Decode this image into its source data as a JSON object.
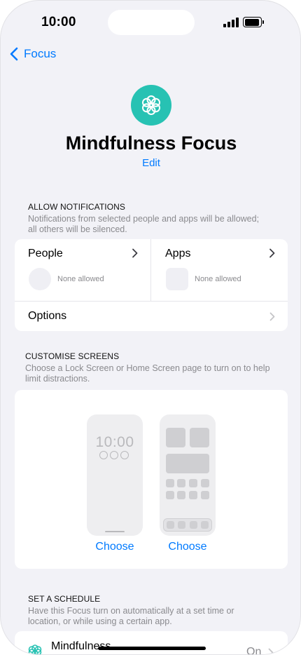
{
  "status_bar": {
    "time": "10:00"
  },
  "nav": {
    "back_label": "Focus"
  },
  "header": {
    "title": "Mindfulness Focus",
    "edit_label": "Edit",
    "icon": "mindfulness-flower-icon",
    "accent_color": "#27c2b3"
  },
  "allow_notifications": {
    "title": "ALLOW NOTIFICATIONS",
    "description": "Notifications from selected people and apps will be allowed; all others will be silenced.",
    "people": {
      "label": "People",
      "status": "None allowed"
    },
    "apps": {
      "label": "Apps",
      "status": "None allowed"
    },
    "options_label": "Options"
  },
  "customise_screens": {
    "title": "CUSTOMISE SCREENS",
    "description": "Choose a Lock Screen or Home Screen page to turn on to help limit distractions.",
    "lock_screen_time": "10:00",
    "lock_choose_label": "Choose",
    "home_choose_label": "Choose"
  },
  "schedule": {
    "title": "SET A SCHEDULE",
    "description": "Have this Focus turn on automatically at a set time or location, or while using a certain app.",
    "item_label": "Mindfulness",
    "item_status": "On"
  },
  "colors": {
    "link_blue": "#007aff",
    "background": "#f2f2f7",
    "secondary_text": "#8a8a8e"
  }
}
